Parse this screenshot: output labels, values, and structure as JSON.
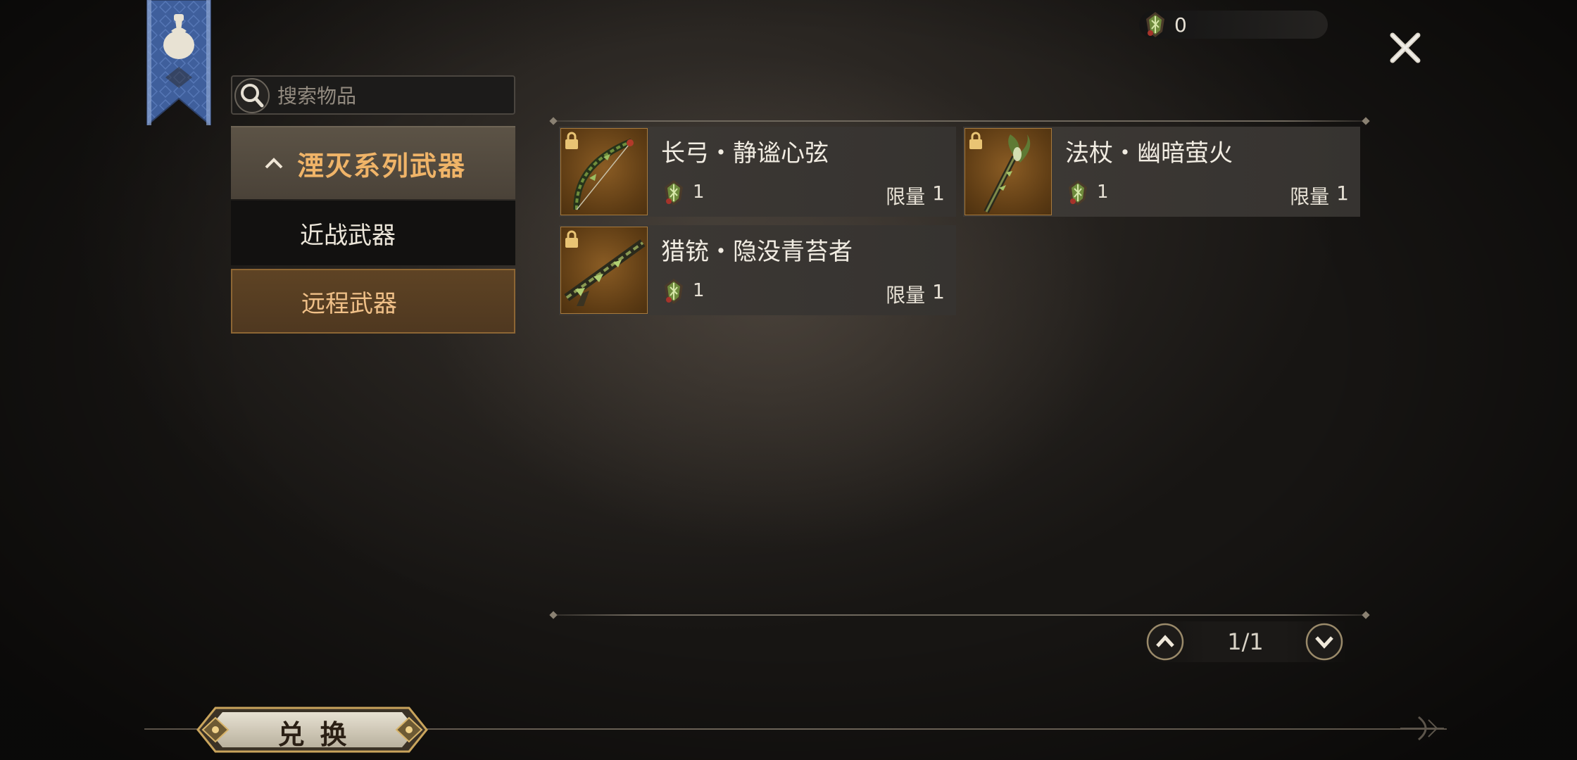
{
  "currency": {
    "value": "0",
    "icon": "moss-gem-icon"
  },
  "search": {
    "placeholder": "搜索物品"
  },
  "categories": {
    "header": "湮灭系列武器",
    "items": [
      {
        "label": "近战武器",
        "selected": false
      },
      {
        "label": "远程武器",
        "selected": true
      }
    ]
  },
  "items": [
    {
      "name": "长弓・静谧心弦",
      "cost": "1",
      "limit_label": "限量",
      "limit_value": "1",
      "icon": "longbow-icon",
      "locked": true
    },
    {
      "name": "法杖・幽暗萤火",
      "cost": "1",
      "limit_label": "限量",
      "limit_value": "1",
      "icon": "staff-icon",
      "locked": true
    },
    {
      "name": "猎铳・隐没青苔者",
      "cost": "1",
      "limit_label": "限量",
      "limit_value": "1",
      "icon": "hunting-gun-icon",
      "locked": true
    }
  ],
  "pager": {
    "page": "1/1"
  },
  "exchange": {
    "label": "兑换"
  },
  "colors": {
    "accent": "#f0b468",
    "selected_bg": "#5e4324",
    "text": "#f1ece2"
  }
}
